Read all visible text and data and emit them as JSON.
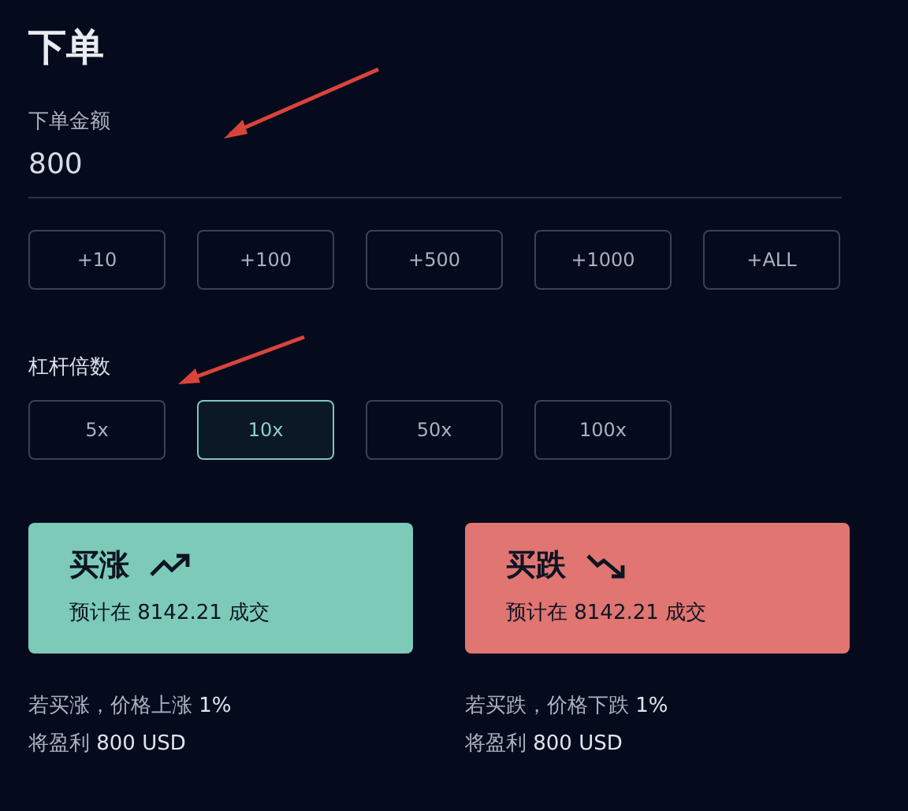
{
  "title": "下单",
  "amount": {
    "label": "下单金额",
    "value": "800"
  },
  "amount_buttons": [
    "+10",
    "+100",
    "+500",
    "+1000",
    "+ALL"
  ],
  "leverage": {
    "label": "杠杆倍数",
    "options": [
      {
        "label": "5x",
        "selected": false
      },
      {
        "label": "10x",
        "selected": true
      },
      {
        "label": "50x",
        "selected": false
      },
      {
        "label": "100x",
        "selected": false
      }
    ]
  },
  "orders": [
    {
      "kind": "up",
      "title": "买涨",
      "estimate": "预计在 8142.21 成交",
      "note_1": "若买涨，价格上涨 **1%**",
      "note_2": "将盈利 **800 USD**"
    },
    {
      "kind": "down",
      "title": "买跌",
      "estimate": "预计在  8142.21  成交",
      "note_1": "若买跌，价格下跌 **1%**",
      "note_2": "将盈利 **800 USD**"
    }
  ]
}
